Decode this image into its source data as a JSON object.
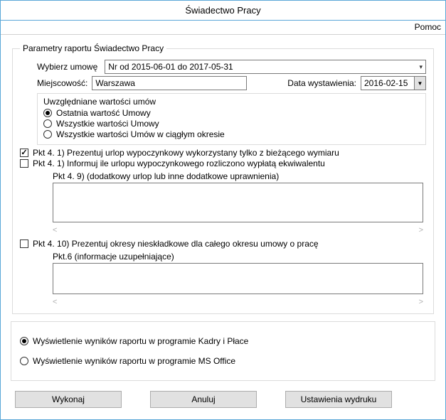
{
  "window": {
    "title": "Świadectwo Pracy"
  },
  "help": {
    "label": "Pomoc"
  },
  "params": {
    "legend": "Parametry raportu  Świadectwo Pracy",
    "contract_label": "Wybierz umowę",
    "contract_value": "Nr  od 2015-06-01 do 2017-05-31",
    "place_label": "Miejscowość:",
    "place_value": "Warszawa",
    "date_label": "Data wystawienia:",
    "date_value": "2016-02-15",
    "values_group": {
      "title": "Uwzględniane wartości umów",
      "options": [
        "Ostatnia wartość Umowy",
        "Wszystkie wartości Umowy",
        "Wszystkie wartości Umów w ciągłym okresie"
      ],
      "selected_index": 0
    },
    "check_pkt4_1a": {
      "checked": true,
      "label": "Pkt 4. 1) Prezentuj urlop wypoczynkowy wykorzystany tylko z bieżącego wymiaru"
    },
    "check_pkt4_1b": {
      "checked": false,
      "label": "Pkt 4. 1) Informuj ile urlopu wypoczynkowego rozliczono wypłatą ekwiwalentu"
    },
    "pkt4_9_label": "Pkt 4. 9) (dodatkowy urlop lub inne dodatkowe uprawnienia)",
    "pkt4_9_value": "",
    "check_pkt4_10": {
      "checked": false,
      "label": "Pkt 4. 10) Prezentuj okresy nieskładkowe dla całego okresu umowy o pracę"
    },
    "pkt6_label": "Pkt.6 (informacje uzupełniające)",
    "pkt6_value": ""
  },
  "output": {
    "options": [
      "Wyświetlenie wyników raportu w programie Kadry i Płace",
      "Wyświetlenie wyników raportu w programie MS Office"
    ],
    "selected_index": 0
  },
  "buttons": {
    "execute": "Wykonaj",
    "cancel": "Anuluj",
    "print_settings": "Ustawienia wydruku"
  }
}
